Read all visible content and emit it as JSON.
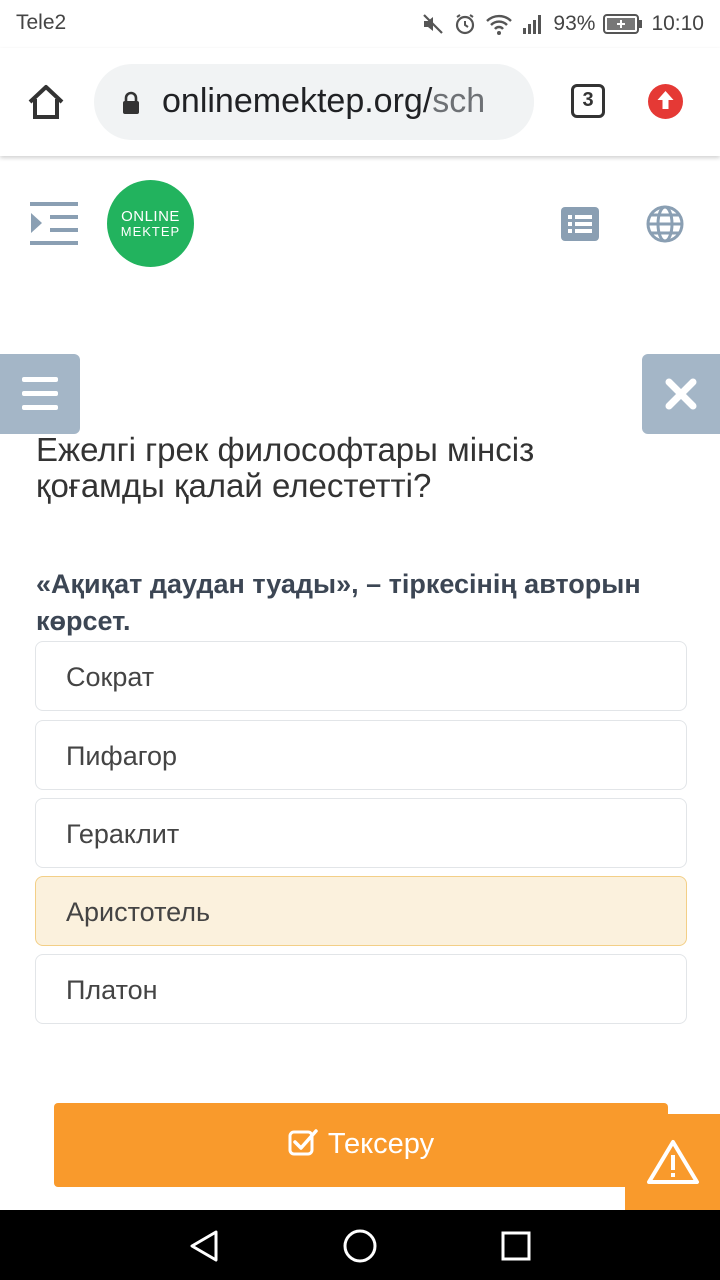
{
  "status_bar": {
    "carrier": "Tele2",
    "battery": "93%",
    "time": "10:10"
  },
  "browser": {
    "url_main": "onlinemektep.org/",
    "url_rest": "sch",
    "tab_count": "3"
  },
  "site": {
    "logo_line1": "ONLINE",
    "logo_line2": "MEKTEP"
  },
  "quiz": {
    "title": "Ежелгі грек философтары мінсіз қоғамды қалай елестетті?",
    "question": "«Ақиқат даудан туады», – тіркесінің авторын көрсет.",
    "options": [
      {
        "label": "Сократ"
      },
      {
        "label": "Пифагор"
      },
      {
        "label": "Гераклит"
      },
      {
        "label": "Аристотель"
      },
      {
        "label": "Платон"
      }
    ],
    "selected_option": "Аристотель",
    "check_label": "Тексеру"
  },
  "colors": {
    "accent": "#f99a2c",
    "logo": "#22b35e",
    "side_buttons": "#a4b6c7",
    "selected_bg": "#fbf1dd"
  }
}
